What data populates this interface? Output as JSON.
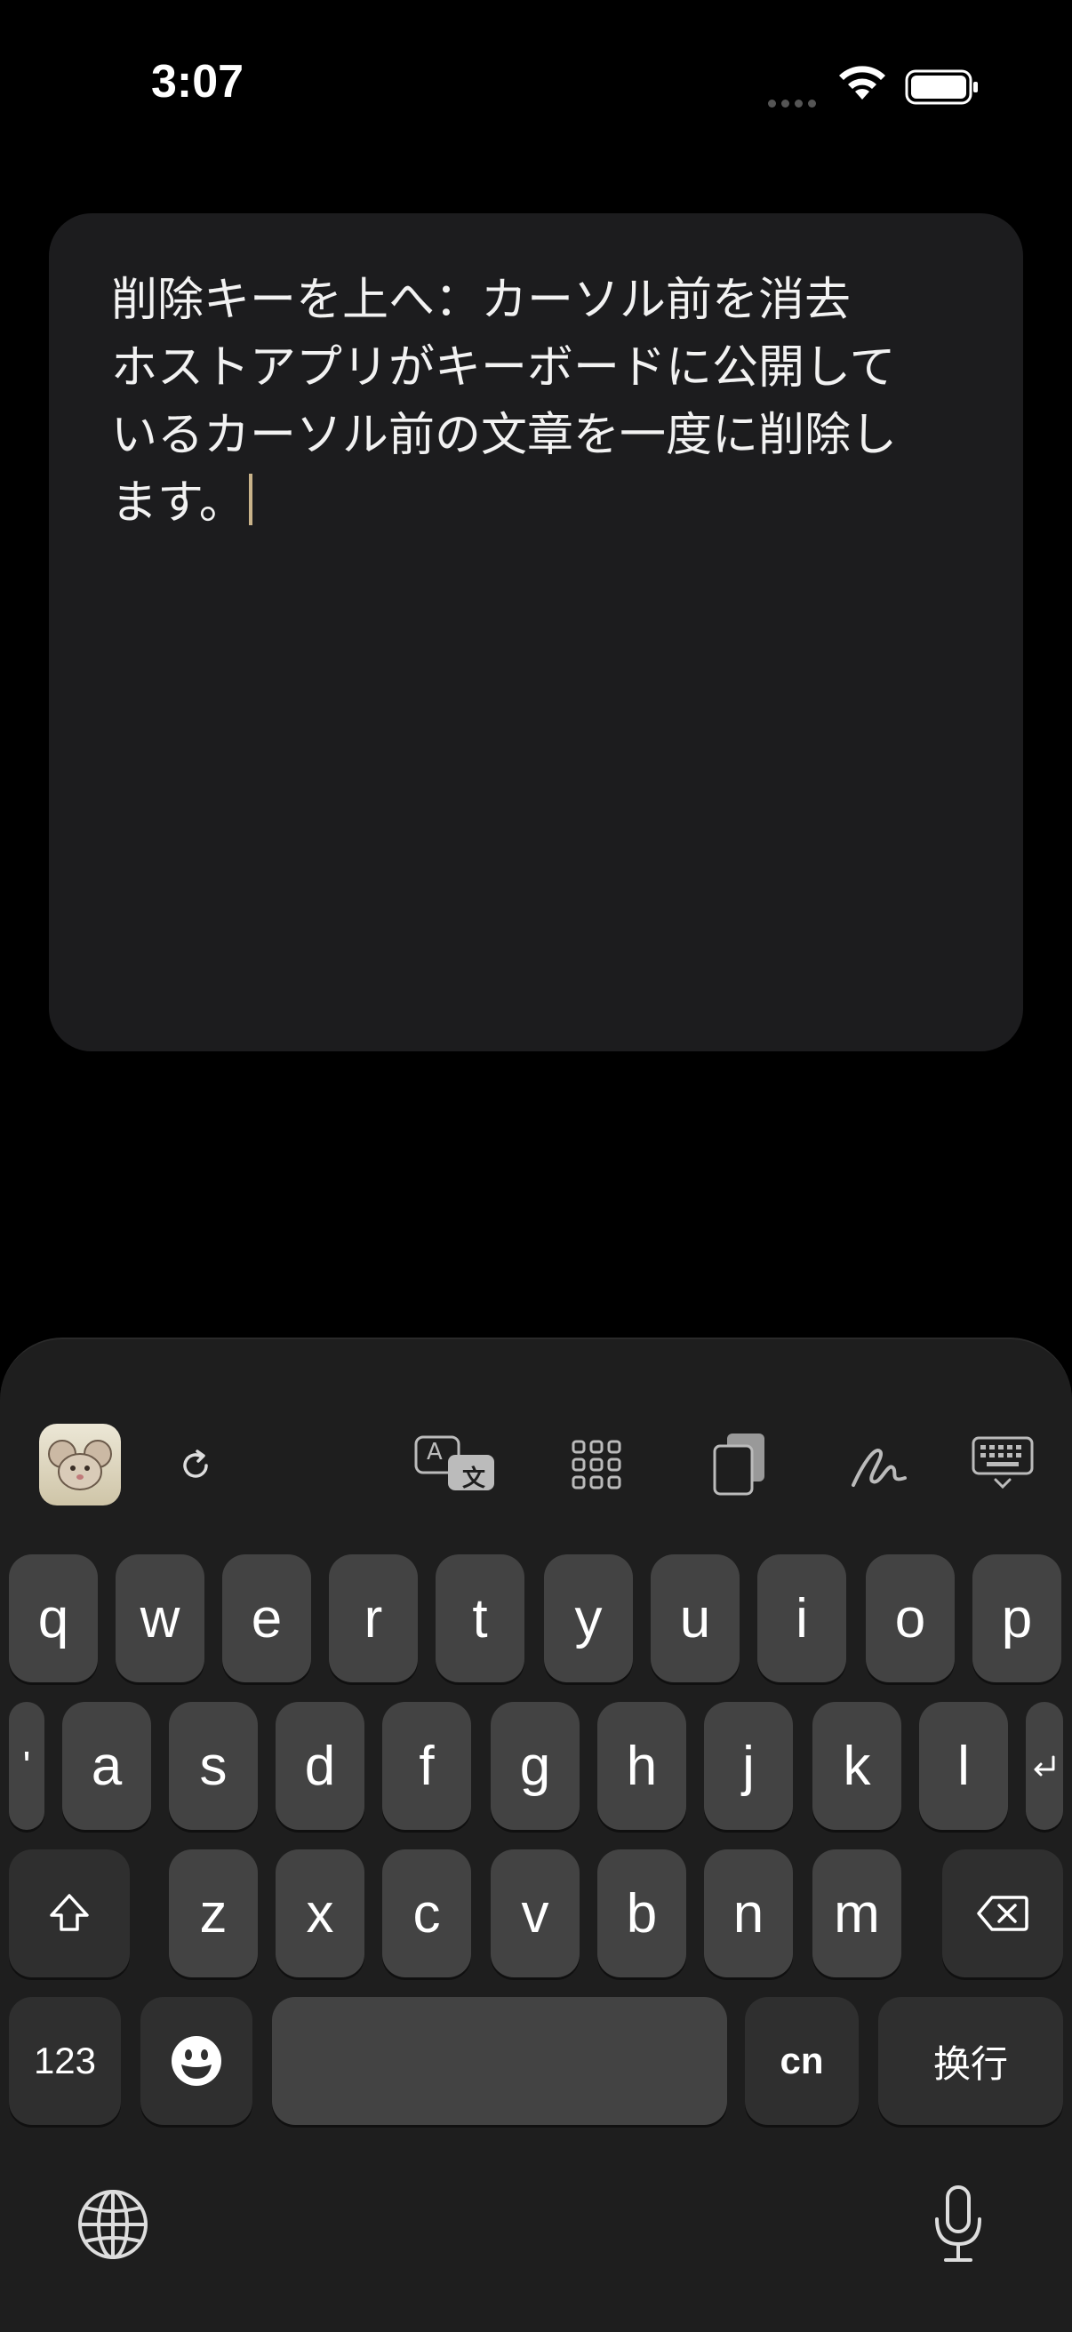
{
  "status_bar": {
    "time": "3:07"
  },
  "editor": {
    "lines": [
      "削除キーを上へ：カーソル前を消去",
      "ホストアプリがキーボードに公開して",
      "いるカーソル前の文章を一度に削除し",
      "ます。"
    ]
  },
  "toolbar": {
    "icons": [
      "app-logo-icon",
      "refresh-icon",
      "translate-icon",
      "grid-icon",
      "clipboard-icon",
      "handwriting-icon",
      "keyboard-dismiss-icon"
    ],
    "translate_a": "A",
    "translate_b": "文"
  },
  "keyboard": {
    "row1": [
      "q",
      "w",
      "e",
      "r",
      "t",
      "y",
      "u",
      "i",
      "o",
      "p"
    ],
    "row2": [
      "a",
      "s",
      "d",
      "f",
      "g",
      "h",
      "j",
      "k",
      "l"
    ],
    "row2_left_partial": "'",
    "row3": [
      "z",
      "x",
      "c",
      "v",
      "b",
      "n",
      "m"
    ],
    "numbers_label": "123",
    "lang_label": "cn",
    "return_label": "换行",
    "space_label": ""
  },
  "colors": {
    "key": "#434343",
    "func_key": "#2f2f2f",
    "keyboard_bg": "#1e1e1e",
    "caret": "#c9b38a"
  }
}
